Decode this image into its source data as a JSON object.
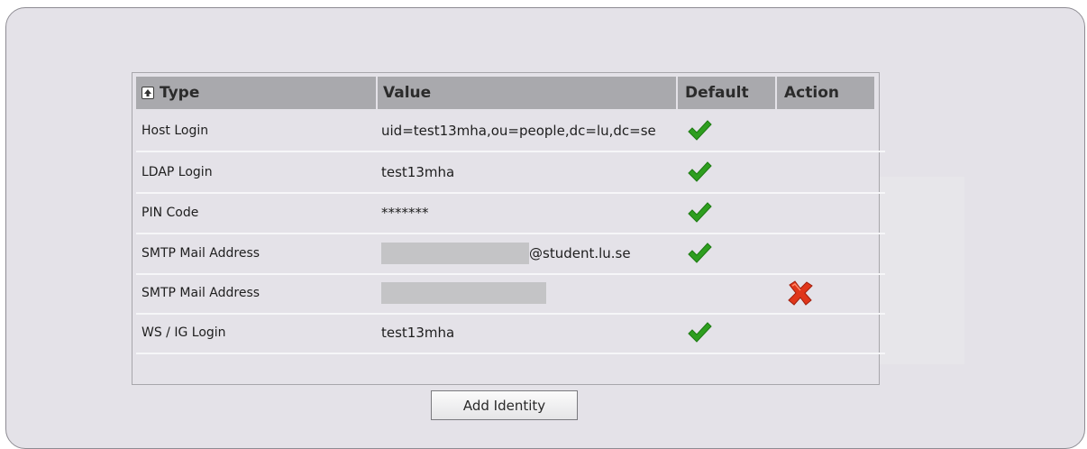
{
  "table": {
    "headers": {
      "type": "Type",
      "value": "Value",
      "default": "Default",
      "action": "Action"
    },
    "rows": [
      {
        "type": "Host Login",
        "value": "uid=test13mha,ou=people,dc=lu,dc=se",
        "default": true,
        "action": ""
      },
      {
        "type": "LDAP Login",
        "value": "test13mha",
        "default": true,
        "action": ""
      },
      {
        "type": "PIN Code",
        "value": "*******",
        "default": true,
        "action": ""
      },
      {
        "type": "SMTP Mail Address",
        "value_redacted": true,
        "value_suffix": "@student.lu.se",
        "default": true,
        "action": ""
      },
      {
        "type": "SMTP Mail Address",
        "value_redacted": true,
        "default": false,
        "action": "delete-icon"
      },
      {
        "type": "WS / IG Login",
        "value": "test13mha",
        "default": true,
        "action": ""
      }
    ]
  },
  "icons": {
    "sort": "sort-up-icon",
    "default": "checkmark-icon",
    "delete": "delete-icon"
  },
  "colors": {
    "check": "#2e9e1f",
    "delete": "#e0361a",
    "header_bg": "#a9a9ad",
    "panel_bg": "#e4e2e8"
  },
  "buttons": {
    "add_identity": "Add Identity"
  }
}
